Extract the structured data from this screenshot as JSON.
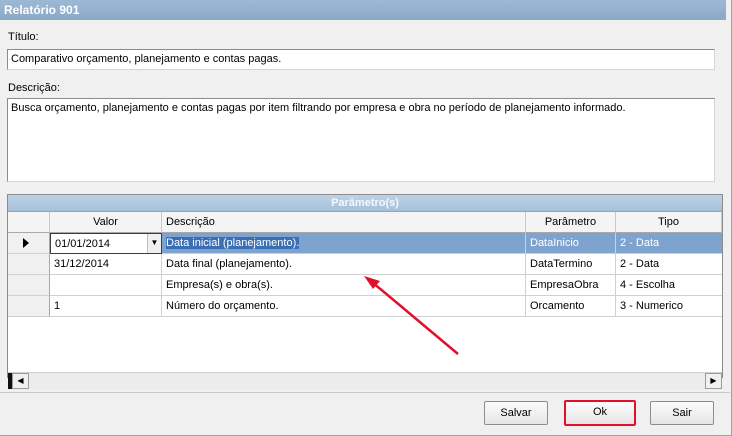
{
  "window": {
    "title": "Relatório 901"
  },
  "form": {
    "titulo_label": "Título:",
    "titulo_value": "Comparativo orçamento, planejamento e contas pagas.",
    "descricao_label": "Descrição:",
    "descricao_value": "Busca orçamento, planejamento e contas pagas por item filtrando por empresa e obra no período de planejamento informado."
  },
  "grid": {
    "caption": "Parâmetro(s)",
    "columns": [
      "Valor",
      "Descrição",
      "Parâmetro",
      "Tipo"
    ],
    "rows": [
      {
        "valor": "01/01/2014",
        "descricao": "Data inicial (planejamento).",
        "parametro": "DataInicio",
        "tipo": "2 - Data",
        "selected": true
      },
      {
        "valor": "31/12/2014",
        "descricao": "Data final (planejamento).",
        "parametro": "DataTermino",
        "tipo": "2 - Data"
      },
      {
        "valor": "",
        "descricao": "Empresa(s) e obra(s).",
        "parametro": "EmpresaObra",
        "tipo": "4 - Escolha"
      },
      {
        "valor": "1",
        "descricao": "Número do orçamento.",
        "parametro": "Orcamento",
        "tipo": "3 - Numerico"
      }
    ]
  },
  "icons": {
    "row_indicator": "row-pointer-icon",
    "dropdown": "chevron-down-icon",
    "scroll_left": "scroll-left-icon",
    "scroll_right": "scroll-right-icon"
  },
  "buttons": {
    "save": "Salvar",
    "ok": "Ok",
    "exit": "Sair"
  },
  "colors": {
    "highlight": "#e0102a",
    "selection": "#7fa3cf",
    "titlebar": "#8aa9c8"
  }
}
